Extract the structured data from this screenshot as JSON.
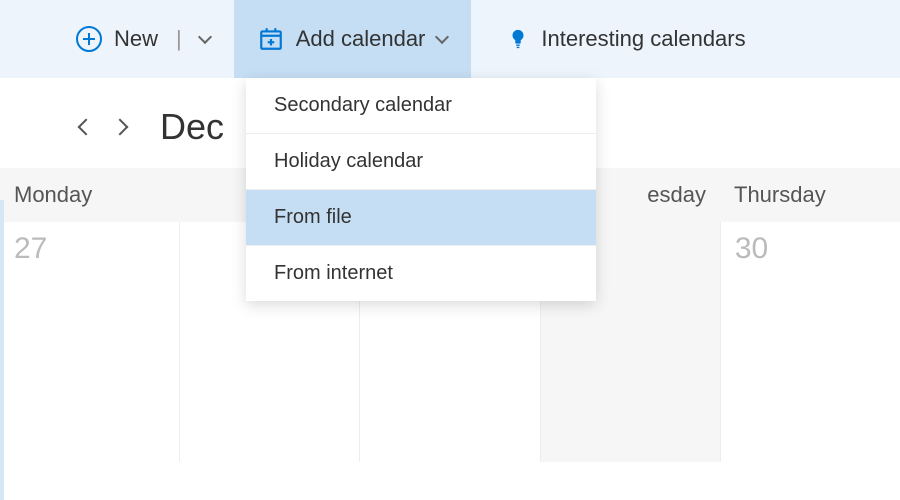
{
  "toolbar": {
    "new_label": "New",
    "add_calendar_label": "Add calendar",
    "interesting_label": "Interesting calendars"
  },
  "dropdown": {
    "items": [
      {
        "label": "Secondary calendar",
        "highlighted": false
      },
      {
        "label": "Holiday calendar",
        "highlighted": false
      },
      {
        "label": "From file",
        "highlighted": true
      },
      {
        "label": "From internet",
        "highlighted": false
      }
    ]
  },
  "calendar": {
    "month_partial": "Dec",
    "days_header": [
      "Monday",
      "",
      "",
      "esday",
      "Thursday"
    ],
    "dates": [
      "27",
      "",
      "",
      "",
      "30"
    ]
  }
}
